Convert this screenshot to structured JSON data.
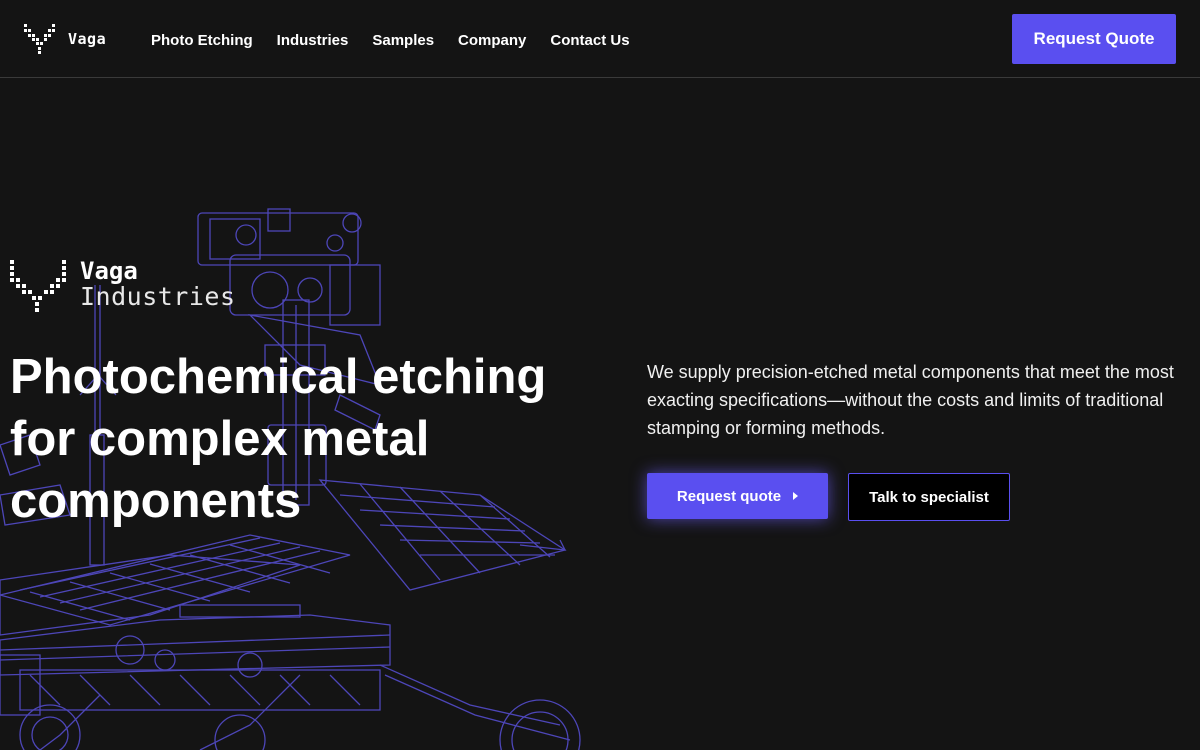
{
  "brand": {
    "name": "Vaga",
    "logo_icon": "vaga-pixel-v-logo"
  },
  "nav": {
    "items": [
      {
        "label": "Photo Etching"
      },
      {
        "label": "Industries"
      },
      {
        "label": "Samples"
      },
      {
        "label": "Company"
      },
      {
        "label": "Contact Us"
      }
    ],
    "cta_label": "Request Quote"
  },
  "hero": {
    "logo": {
      "line1": "Vaga",
      "line2": "Industries"
    },
    "title": "Photochemical etching for complex metal components",
    "description": "We supply precision-etched metal components that meet the most exacting specifications—without the costs and limits of traditional stamping or forming methods.",
    "primary_button": "Request quote",
    "secondary_button": "Talk to specialist",
    "background_art": "rover-line-drawing"
  },
  "colors": {
    "background": "#141414",
    "accent": "#5a4ff0",
    "line_art": "#4d46b8",
    "text": "#ffffff"
  }
}
